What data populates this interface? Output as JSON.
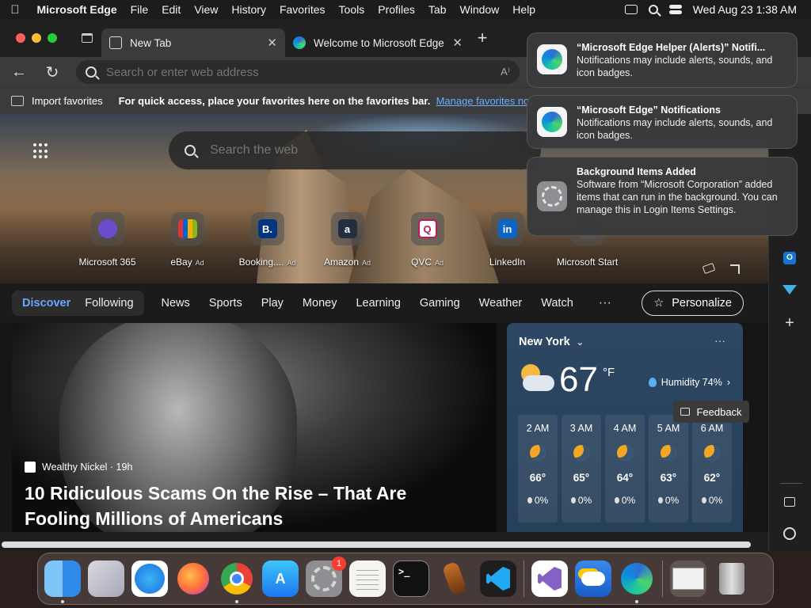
{
  "menubar": {
    "app_name": "Microsoft Edge",
    "items": [
      "File",
      "Edit",
      "View",
      "History",
      "Favorites",
      "Tools",
      "Profiles",
      "Tab",
      "Window",
      "Help"
    ],
    "clock": "Wed Aug 23  1:38 AM"
  },
  "tabs": [
    {
      "label": "New Tab",
      "close": "✕"
    },
    {
      "label": "Welcome to Microsoft Edge",
      "close": "✕"
    }
  ],
  "newtab_symbol": "+",
  "address": {
    "placeholder": "Search or enter web address",
    "read_aloud": "A⁾"
  },
  "favbar": {
    "import_label": "Import favorites",
    "hint": "For quick access, place your favorites here on the favorites bar.",
    "link": "Manage favorites now"
  },
  "newtab": {
    "search_placeholder": "Search the web",
    "quicklinks": [
      {
        "label": "Microsoft 365",
        "ad": "",
        "glyph": "",
        "color": "#6b4cc9"
      },
      {
        "label": "eBay",
        "ad": "Ad",
        "glyph": "",
        "color": "#e53238"
      },
      {
        "label": "Booking....",
        "ad": "Ad",
        "glyph": "B.",
        "color": "#003580"
      },
      {
        "label": "Amazon",
        "ad": "Ad",
        "glyph": "a",
        "color": "#232f3e"
      },
      {
        "label": "QVC",
        "ad": "Ad",
        "glyph": "Q",
        "color": "#ffffff"
      },
      {
        "label": "LinkedIn",
        "ad": "",
        "glyph": "in",
        "color": "#0a66c2"
      },
      {
        "label": "Microsoft Start",
        "ad": "",
        "glyph": "",
        "color": "#555555"
      }
    ]
  },
  "feed": {
    "pill_tabs": [
      "Discover",
      "Following"
    ],
    "tabs": [
      "News",
      "Sports",
      "Play",
      "Money",
      "Learning",
      "Gaming",
      "Weather",
      "Watch"
    ],
    "more": "···",
    "personalize": "Personalize"
  },
  "story": {
    "source": "Wealthy Nickel · 19h",
    "title": "10 Ridiculous Scams On the Rise – That Are Fooling Millions of Americans"
  },
  "weather": {
    "city": "New York",
    "more": "···",
    "temp": "67",
    "unit": "°F",
    "humidity": "Humidity 74%",
    "hours": [
      {
        "time": "2 AM",
        "temp": "66°",
        "precip": "0%"
      },
      {
        "time": "3 AM",
        "temp": "65°",
        "precip": "0%"
      },
      {
        "time": "4 AM",
        "temp": "64°",
        "precip": "0%"
      },
      {
        "time": "5 AM",
        "temp": "63°",
        "precip": "0%"
      },
      {
        "time": "6 AM",
        "temp": "62°",
        "precip": "0%"
      }
    ]
  },
  "feedback": "Feedback",
  "notifications": [
    {
      "title": "“Microsoft Edge Helper (Alerts)” Notifi...",
      "body": "Notifications may include alerts, sounds, and icon badges."
    },
    {
      "title": "“Microsoft Edge” Notifications",
      "body": "Notifications may include alerts, sounds, and icon badges."
    },
    {
      "title": "Background Items Added",
      "body": "Software from “Microsoft Corporation” added items that can run in the background. You can manage this in Login Items Settings."
    }
  ],
  "dock": {
    "apps": [
      "finder",
      "launchpad",
      "safari",
      "firefox",
      "chrome",
      "app-store",
      "system-settings",
      "textedit",
      "terminal",
      "garageband",
      "vscode",
      "visual-studio",
      "weather",
      "edge",
      "downloads",
      "trash"
    ],
    "system_settings_badge": "1",
    "terminal_prompt": ">_"
  }
}
